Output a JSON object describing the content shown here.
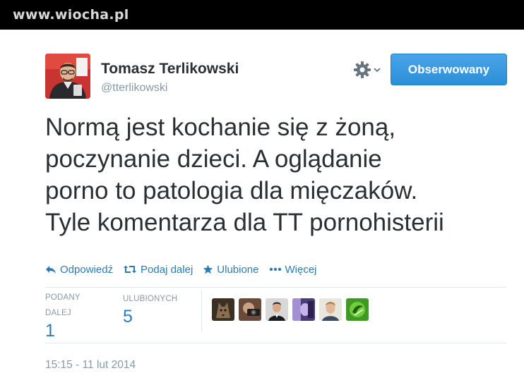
{
  "watermark": "www.wiocha.pl",
  "tweet": {
    "author_name": "Tomasz Terlikowski",
    "author_handle": "@tterlikowski",
    "follow_button_label": "Obserwowany",
    "text_lines": [
      "Normą jest kochanie się z żoną,",
      "poczynanie dzieci. A oglądanie",
      "porno to patologia dla mięczaków.",
      "Tyle komentarza dla TT pornohisterii"
    ],
    "actions": [
      {
        "label": "Odpowiedź",
        "icon": "reply-icon"
      },
      {
        "label": "Podaj dalej",
        "icon": "retweet-icon"
      },
      {
        "label": "Ulubione",
        "icon": "star-icon"
      },
      {
        "label": "Więcej",
        "icon": "more-icon"
      }
    ],
    "stats": {
      "retweets_label_line1": "PODANY",
      "retweets_label_line2": "DALEJ",
      "retweets_count": "1",
      "favorites_label": "ULUBIONYCH",
      "favorites_count": "5"
    },
    "favoriter_avatars": [
      "avatar-wolf",
      "avatar-camera",
      "avatar-man-suit",
      "avatar-purple",
      "avatar-blond-man",
      "avatar-green-logo"
    ],
    "timestamp": "15:15 - 11 lut 2014"
  },
  "colors": {
    "link_blue": "#2b7bb9",
    "follow_button": "#3d9ae3",
    "muted_text": "#8899a6",
    "body_text": "#292f33",
    "topbar": "#000000"
  }
}
